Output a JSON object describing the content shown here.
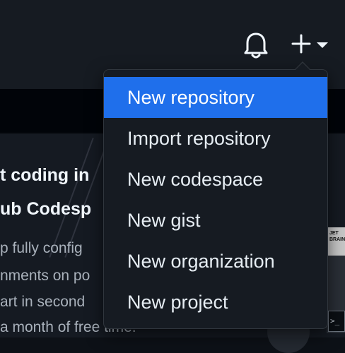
{
  "header": {
    "notifications_icon": "bell-icon",
    "create_icon": "plus-icon",
    "caret_icon": "triangle-down-icon"
  },
  "promo": {
    "title_line1": "t coding in",
    "title_line2": "ub Codesp",
    "text_line1": "p fully config",
    "text_line2": "nments on po",
    "text_line3": "art in second",
    "text_line4": "a month of free time."
  },
  "thumbnail": {
    "badge_text": "JET BRAINS",
    "terminal_text": ">_"
  },
  "create_menu": {
    "items": [
      {
        "label": "New repository"
      },
      {
        "label": "Import repository"
      },
      {
        "label": "New codespace"
      },
      {
        "label": "New gist"
      },
      {
        "label": "New organization"
      },
      {
        "label": "New project"
      }
    ],
    "active_index": 0
  },
  "colors": {
    "header_bg": "#161b22",
    "page_bg": "#0d1117",
    "menu_highlight": "#1f6feb",
    "text": "#e6edf3"
  }
}
